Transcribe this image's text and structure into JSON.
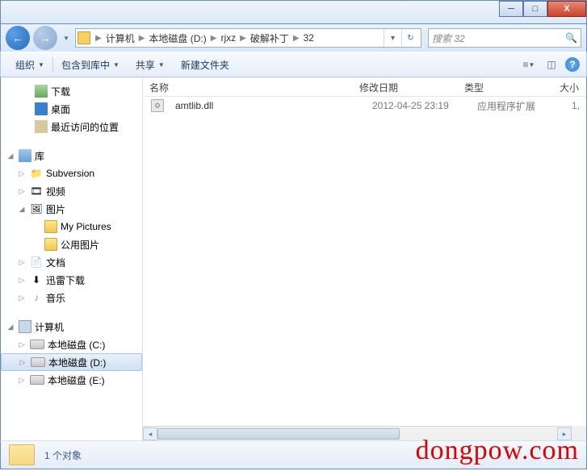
{
  "titlebar": {},
  "nav": {
    "breadcrumbs": [
      "计算机",
      "本地磁盘 (D:)",
      "rjxz",
      "破解补丁",
      "32"
    ],
    "search_placeholder": "搜索 32"
  },
  "toolbar": {
    "organize": "组织",
    "include": "包含到库中",
    "share": "共享",
    "newfolder": "新建文件夹"
  },
  "tree": {
    "downloads": "下载",
    "desktop": "桌面",
    "recent": "最近访问的位置",
    "libraries": "库",
    "subversion": "Subversion",
    "videos": "视频",
    "pictures": "图片",
    "my_pictures": "My Pictures",
    "public_pictures": "公用图片",
    "documents": "文档",
    "xunlei": "迅雷下载",
    "music": "音乐",
    "computer": "计算机",
    "drive_c": "本地磁盘 (C:)",
    "drive_d": "本地磁盘 (D:)",
    "drive_e": "本地磁盘 (E:)"
  },
  "columns": {
    "name": "名称",
    "date": "修改日期",
    "type": "类型",
    "size": "大小"
  },
  "files": [
    {
      "name": "amtlib.dll",
      "date": "2012-04-25 23:19",
      "type": "应用程序扩展",
      "size": "1,"
    }
  ],
  "status": {
    "text": "1 个对象"
  },
  "watermark": "dongpow.com"
}
